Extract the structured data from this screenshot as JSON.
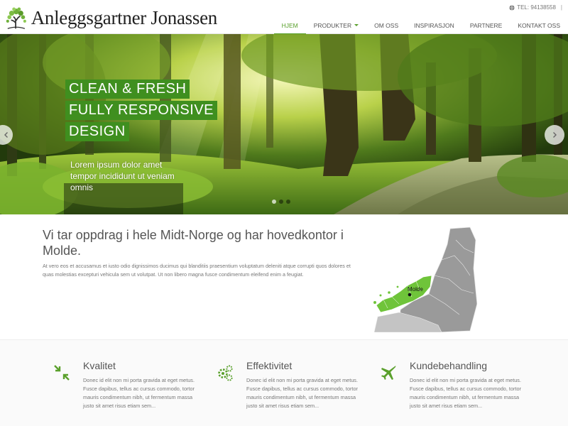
{
  "header": {
    "logo_text": "Anleggsgartner Jonassen",
    "phone": "TEL: 94138558",
    "phone_suffix": "|",
    "nav": [
      {
        "label": "HJEM",
        "active": true
      },
      {
        "label": "PRODUKTER",
        "dropdown": true
      },
      {
        "label": "OM OSS"
      },
      {
        "label": "INSPIRASJON"
      },
      {
        "label": "PARTNERE"
      },
      {
        "label": "KONTAKT OSS"
      }
    ]
  },
  "hero": {
    "heading_lines": [
      "CLEAN & FRESH",
      "FULLY RESPONSIVE",
      "DESIGN"
    ],
    "subtext": "Lorem ipsum dolor amet tempor incididunt ut veniam omnis",
    "slide_count": 3,
    "active_slide": 1
  },
  "intro": {
    "title": "Vi tar oppdrag i hele Midt-Norge og har hovedkontor i Molde.",
    "text": "At vero eos et accusamus et iusto odio dignissimos ducimus qui blanditiis praesentium voluptatum deleniti atque corrupti quos dolores et quas molestias excepturi vehicula sem ut volutpat. Ut non libero magna fusce condimentum eleifend enim a feugiat.",
    "map_label": "Molde"
  },
  "features": [
    {
      "icon": "compress-arrows-icon",
      "title": "Kvalitet",
      "text": "Donec id elit non mi porta gravida at eget metus. Fusce dapibus, tellus ac cursus commodo, tortor mauris condimentum nibh, ut fermentum massa justo sit amet risus etiam sem..."
    },
    {
      "icon": "gears-icon",
      "title": "Effektivitet",
      "text": "Donec id elit non mi porta gravida at eget metus. Fusce dapibus, tellus ac cursus commodo, tortor mauris condimentum nibh, ut fermentum massa justo sit amet risus etiam sem..."
    },
    {
      "icon": "plane-icon",
      "title": "Kundebehandling",
      "text": "Donec id elit non mi porta gravida at eget metus. Fusce dapibus, tellus ac cursus commodo, tortor mauris condimentum nibh, ut fermentum massa justo sit amet risus etiam sem..."
    }
  ],
  "colors": {
    "accent": "#5aa02c",
    "hero_label_bg": "#3f8f1f",
    "map_green": "#6fc43a",
    "map_gray": "#8f8f8f"
  }
}
